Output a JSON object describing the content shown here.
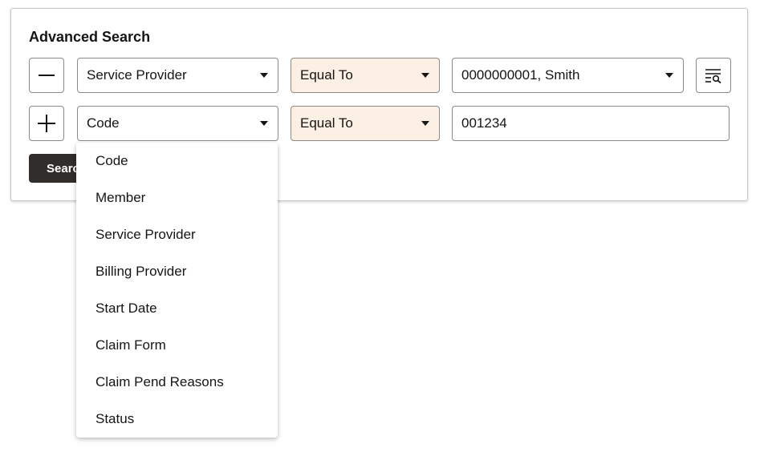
{
  "panel": {
    "title": "Advanced Search",
    "search_button_label": "Search"
  },
  "rows": [
    {
      "toggle_icon": "minus-icon",
      "field_value": "Service Provider",
      "operator_value": "Equal To",
      "value": "0000000001, Smith",
      "has_value_dropdown": true,
      "lookup_icon": "search-list-icon"
    },
    {
      "toggle_icon": "plus-icon",
      "field_value": "Code",
      "operator_value": "Equal To",
      "value": "001234"
    }
  ],
  "field_dropdown": {
    "options": [
      "Code",
      "Member",
      "Service Provider",
      "Billing Provider",
      "Start Date",
      "Claim Form",
      "Claim Pend Reasons",
      "Status"
    ]
  },
  "colors": {
    "operator_background": "#fcefe3",
    "primary_button": "#312d2a",
    "border": "#8c8a85"
  }
}
